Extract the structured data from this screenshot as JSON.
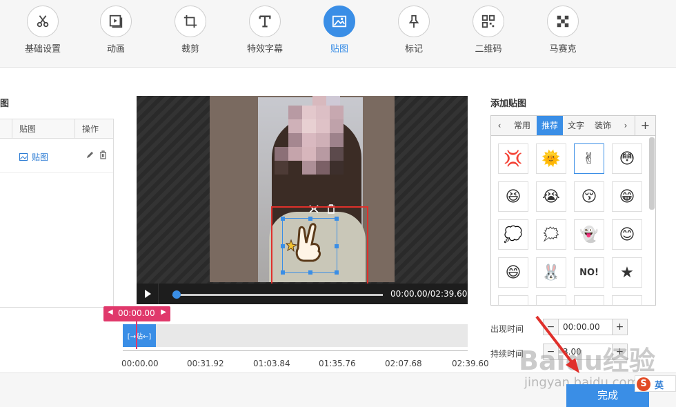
{
  "toolbar": {
    "items": [
      {
        "label": "基础设置",
        "icon": "scissors-icon"
      },
      {
        "label": "动画",
        "icon": "play-frame-icon"
      },
      {
        "label": "裁剪",
        "icon": "crop-icon"
      },
      {
        "label": "特效字幕",
        "icon": "text-icon"
      },
      {
        "label": "贴图",
        "icon": "image-icon"
      },
      {
        "label": "标记",
        "icon": "pin-icon"
      },
      {
        "label": "二维码",
        "icon": "qrcode-icon"
      },
      {
        "label": "马赛克",
        "icon": "mosaic-icon"
      }
    ],
    "active": "贴图"
  },
  "left_panel": {
    "title": "图",
    "columns": [
      "贴图",
      "操作"
    ],
    "rows": [
      {
        "name": "贴图"
      }
    ]
  },
  "player": {
    "time": "00:00.00/02:39.60",
    "progress": 0
  },
  "timeline": {
    "current": "00:00.00",
    "clip_label": "[→贴←]",
    "ticks": [
      "00:00.00",
      "00:31.92",
      "01:03.84",
      "01:35.76",
      "02:07.68",
      "02:39.60"
    ]
  },
  "stickers": {
    "title": "添加贴图",
    "tabs": [
      "常用",
      "推荐",
      "文字",
      "装饰"
    ],
    "active_tab": "推荐",
    "items": [
      "💢",
      "🌞",
      "✌",
      "😳",
      "😆",
      "😭",
      "😚",
      "😁",
      "💭",
      "🗯",
      "👻",
      "😊",
      "😄",
      "🐰",
      "NO!",
      "★"
    ]
  },
  "fields": {
    "appear_label": "出现时间",
    "appear_value": "00:00.00",
    "duration_label": "持续时间",
    "duration_value": "3.00"
  },
  "done_label": "完成",
  "watermark": {
    "text": "Baidu经验",
    "url": "jingyan.baidu.com"
  },
  "ime": {
    "logo": "S",
    "mode": "英"
  },
  "colors": {
    "accent": "#3a8ee6",
    "marker": "#e0386b",
    "highlight": "#e0302b"
  }
}
